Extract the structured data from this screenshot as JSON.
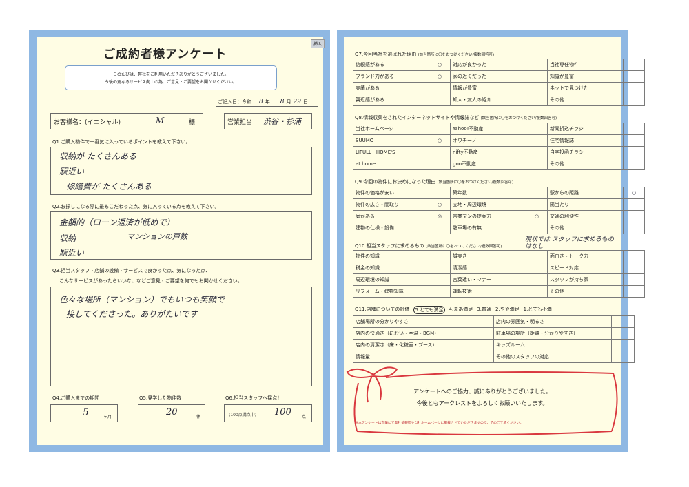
{
  "left": {
    "tab": "挿入",
    "title": "ご成約者様アンケート",
    "intro": [
      "このたびは、弊社をご利用いただきありがとうございました。",
      "今後の更なるサービス向上の為、ご意見・ご要望をお聞かせください。"
    ],
    "date": {
      "label": "ご記入日：令和",
      "year": "8",
      "year_unit": "年",
      "month": "8",
      "month_unit": "月",
      "day": "29",
      "day_unit": "日"
    },
    "customer": {
      "label": "お客様名：(イニシャル)",
      "value": "M",
      "suffix": "様"
    },
    "staff": {
      "label": "営業担当",
      "value": "渋谷・杉浦"
    },
    "q1": {
      "label": "Q1.ご購入物件で一番気に入っているポイントを教えて下さい。",
      "answers": [
        "収納が たくさんある",
        "駅近い",
        "修繕費が たくさんある"
      ]
    },
    "q2": {
      "label": "Q2.お探しになる際に最もこだわった点、気に入っている点を教えて下さい。",
      "answers": [
        "金額的（ローン返済が低めで）",
        "収納",
        "マンションの戸数",
        "駅近い"
      ]
    },
    "q3": {
      "label_lines": [
        "Q3.担当スタッフ・店舗の設備・サービスで良かった点、気になった点、",
        "こんなサービスがあったらいいな、などご意見・ご要望を何でもお聞かせください。"
      ],
      "answers": [
        "色々な場所（マンション）でもいつも笑顔で",
        "接してくださった。ありがたいです"
      ]
    },
    "q4": {
      "label": "Q4.ご購入までの期間",
      "value": "5",
      "unit": "ヶ月"
    },
    "q5": {
      "label": "Q5.見学した物件数",
      "value": "20",
      "unit": "件"
    },
    "q6": {
      "label": "Q6.担当スタッフへ採点！",
      "prefix": "(100点満点中)",
      "value": "100",
      "unit": "点"
    }
  },
  "right": {
    "q7": {
      "label": "Q7.今回当社を選ばれた理由",
      "note": "(該当箇所に〇をおつけください/複数回答可)",
      "rows": [
        [
          "信頼感がある",
          "○",
          "対応が良かった",
          "",
          "当社専任物件",
          ""
        ],
        [
          "ブランド力がある",
          "○",
          "家の近くだった",
          "",
          "知識が豊富",
          ""
        ],
        [
          "実績がある",
          "",
          "情報が豊富",
          "",
          "ネットで見つけた",
          ""
        ],
        [
          "親近感がある",
          "",
          "知人・友人の紹介",
          "",
          "その他",
          ""
        ]
      ]
    },
    "q8": {
      "label": "Q8.情報収集をされたインターネットサイトや情報誌など",
      "note": "(該当箇所に〇をおつけください/複数回答可)",
      "rows": [
        [
          "当社ホームページ",
          "",
          "Yahoo!不動産",
          "",
          "新聞折込チラシ",
          ""
        ],
        [
          "SUUMO",
          "○",
          "オウチーノ",
          "",
          "住宅情報誌",
          ""
        ],
        [
          "LIFULL　HOME'S",
          "",
          "nifty不動産",
          "",
          "自宅投函チラシ",
          ""
        ],
        [
          "at home",
          "",
          "goo不動産",
          "",
          "その他",
          ""
        ]
      ]
    },
    "q9": {
      "label": "Q9.今回の物件にお決めになった理由",
      "note": "(該当箇所に〇をおつけください/複数回答可)",
      "rows": [
        [
          "物件の価格が安い",
          "",
          "築年数",
          "",
          "駅からの距離",
          "○"
        ],
        [
          "物件の広さ・間取り",
          "○",
          "立地・周辺環境",
          "",
          "陽当たり",
          ""
        ],
        [
          "庭がある",
          "◎",
          "営業マンの提案力",
          "○",
          "交通の利便性",
          ""
        ],
        [
          "建物の仕様・設備",
          "",
          "駐車場の有無",
          "",
          "その他",
          ""
        ]
      ]
    },
    "q10": {
      "label": "Q10.担当スタッフに求めるもの",
      "note": "(該当箇所に〇をおつけください/複数回答可)",
      "handwritten": "現状では スタッフに求めるものはなし",
      "rows": [
        [
          "物件の知識",
          "",
          "誠実さ",
          "",
          "面白さ・トーク力",
          ""
        ],
        [
          "税金の知識",
          "",
          "清潔感",
          "",
          "スピード対応",
          ""
        ],
        [
          "周辺環境の知識",
          "",
          "言葉遣い・マナー",
          "",
          "スタッフが持ち家",
          ""
        ],
        [
          "リフォーム・建物知識",
          "",
          "運転技術",
          "",
          "その他",
          ""
        ]
      ]
    },
    "q11": {
      "label": "Q11.店舗についての評価",
      "scale": [
        "5.とても満足",
        "4.まあ満足",
        "3.普通",
        "2.やや満足",
        "1.とても不満"
      ],
      "circled": "5",
      "rows": [
        [
          "店舗場所の分かりやすさ",
          "",
          "店内の雰囲気・明るさ",
          ""
        ],
        [
          "店内の快適さ（におい・室温・BGM）",
          "",
          "駐車場の場所（距離・分かりやすさ）",
          ""
        ],
        [
          "店内の清潔さ（床・化粧室・ブース）",
          "",
          "キッズルーム",
          ""
        ],
        [
          "情報量",
          "",
          "その他のスタッフの対応",
          ""
        ]
      ]
    },
    "thanks": [
      "アンケートへのご協力、誠にありがとうございました。",
      "今後ともアークレストをよろしくお願いいたします。"
    ],
    "footnote": "※本アンケートは直筆にて弊社情報誌や当社ホームページに掲載させていただきますので、予めご了承ください。"
  },
  "colors": {
    "frame": "#8fb8e3",
    "paper": "#fffde4",
    "ribbon": "#d9383f",
    "ink": "#2a2a3a"
  }
}
